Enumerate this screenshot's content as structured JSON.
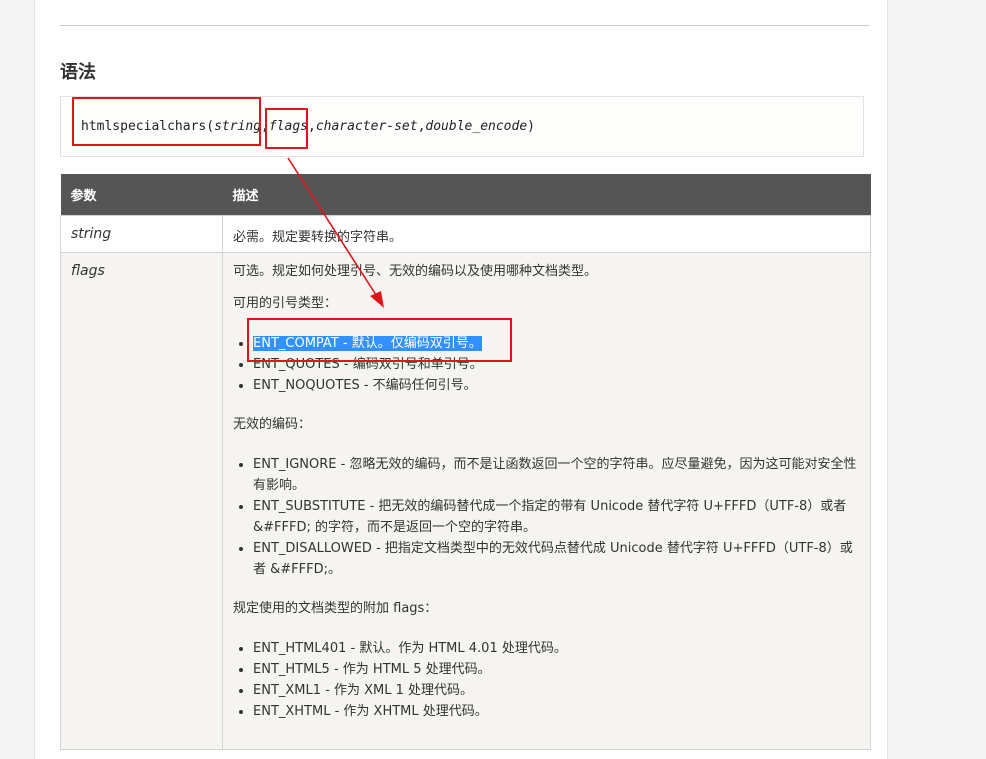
{
  "heading": "语法",
  "syntax": {
    "func": "htmlspecialchars(",
    "arg_string": "string",
    "comma1": ",",
    "arg_flags": "flags",
    "comma2": ",",
    "arg_charset": "character-set",
    "comma3": ",",
    "arg_double": "double_encode",
    "close": ")"
  },
  "table": {
    "headers": [
      "参数",
      "描述"
    ],
    "row1": {
      "param": "string",
      "desc": "必需。规定要转换的字符串。"
    },
    "row2": {
      "param": "flags",
      "intro": "可选。规定如何处理引号、无效的编码以及使用哪种文档类型。",
      "quote_title": "可用的引号类型：",
      "quote_items": [
        "ENT_COMPAT - 默认。仅编码双引号。",
        "ENT_QUOTES - 编码双引号和单引号。",
        "ENT_NOQUOTES - 不编码任何引号。"
      ],
      "invalid_title": "无效的编码：",
      "invalid_items": [
        "ENT_IGNORE - 忽略无效的编码，而不是让函数返回一个空的字符串。应尽量避免，因为这可能对安全性有影响。",
        "ENT_SUBSTITUTE - 把无效的编码替代成一个指定的带有 Unicode 替代字符 U+FFFD（UTF-8）或者 &#FFFD; 的字符，而不是返回一个空的字符串。",
        "ENT_DISALLOWED - 把指定文档类型中的无效代码点替代成 Unicode 替代字符 U+FFFD（UTF-8）或者 &#FFFD;。"
      ],
      "doctype_title": "规定使用的文档类型的附加 flags：",
      "doctype_items": [
        "ENT_HTML401 - 默认。作为 HTML 4.01 处理代码。",
        "ENT_HTML5 - 作为 HTML 5 处理代码。",
        "ENT_XML1 - 作为 XML 1 处理代码。",
        "ENT_XHTML - 作为 XHTML 处理代码。"
      ]
    }
  },
  "colors": {
    "header_bg": "#555555",
    "annotation": "#e0141b",
    "selection": "#3390ff"
  }
}
